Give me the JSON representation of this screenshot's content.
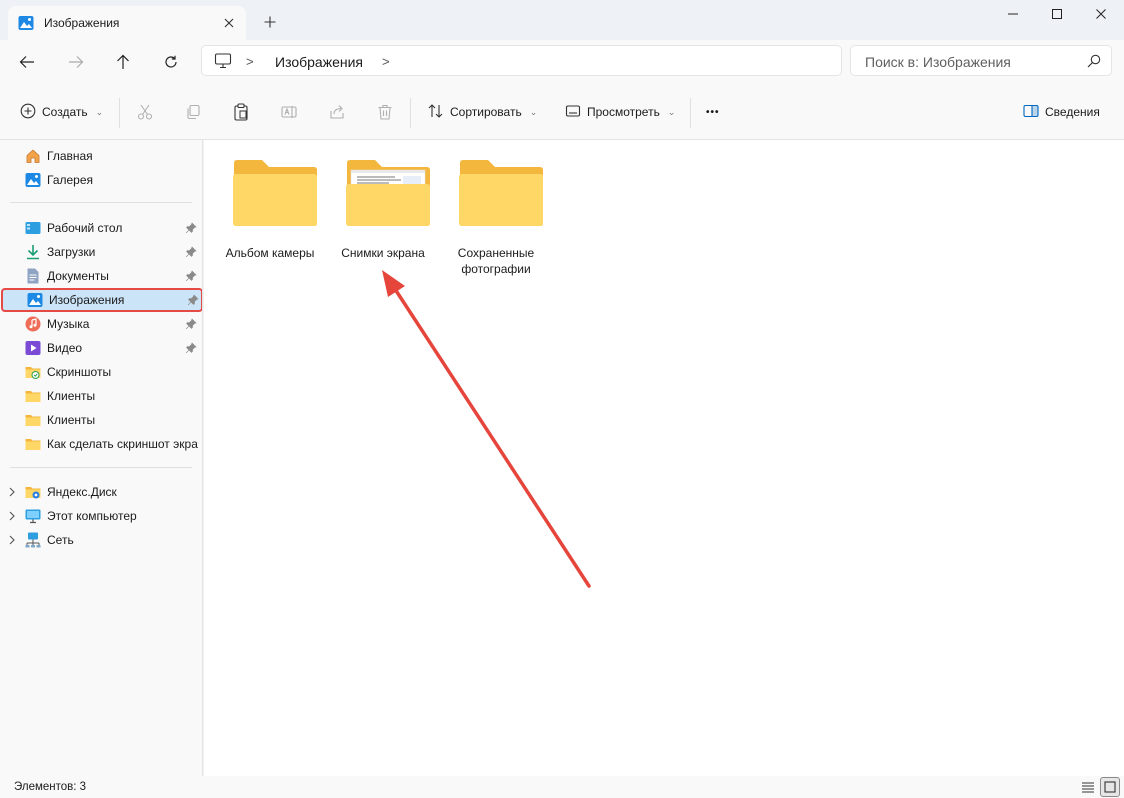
{
  "window": {
    "tab_title": "Изображения",
    "new_tab": "+"
  },
  "address": {
    "path_separator": ">",
    "path_current": "Изображения",
    "search_placeholder": "Поиск в: Изображения"
  },
  "commands": {
    "create": "Создать",
    "sort": "Сортировать",
    "view": "Просмотреть",
    "more": "•••",
    "details": "Сведения"
  },
  "sidebar": {
    "top": [
      {
        "label": "Главная",
        "icon": "home-icon"
      },
      {
        "label": "Галерея",
        "icon": "gallery-icon"
      }
    ],
    "quick_access": [
      {
        "label": "Рабочий стол",
        "icon": "desktop-icon",
        "pinned": true
      },
      {
        "label": "Загрузки",
        "icon": "downloads-icon",
        "pinned": true
      },
      {
        "label": "Документы",
        "icon": "documents-icon",
        "pinned": true
      },
      {
        "label": "Изображения",
        "icon": "pictures-icon",
        "pinned": true,
        "selected": true
      },
      {
        "label": "Музыка",
        "icon": "music-icon",
        "pinned": true
      },
      {
        "label": "Видео",
        "icon": "video-icon",
        "pinned": true
      },
      {
        "label": "Скриншоты",
        "icon": "folder-icon"
      },
      {
        "label": "Клиенты",
        "icon": "folder-icon"
      },
      {
        "label": "Клиенты",
        "icon": "folder-icon"
      },
      {
        "label": "Как сделать скриншот экра",
        "icon": "folder-icon"
      }
    ],
    "locations": [
      {
        "label": "Яндекс.Диск",
        "icon": "yandex-disk-icon"
      },
      {
        "label": "Этот компьютер",
        "icon": "computer-icon"
      },
      {
        "label": "Сеть",
        "icon": "network-icon"
      }
    ]
  },
  "content": {
    "folders": [
      {
        "name": "Альбом камеры"
      },
      {
        "name": "Снимки экрана"
      },
      {
        "name": "Сохраненные фотографии"
      }
    ]
  },
  "status": {
    "items_count": "Элементов: 3"
  },
  "colors": {
    "accent": "#0067c0",
    "selection": "#cce4f7",
    "highlight_border": "#e64a45",
    "annotation_arrow": "#e5453b",
    "folder_back": "#f4b73d",
    "folder_front": "#ffd766"
  }
}
